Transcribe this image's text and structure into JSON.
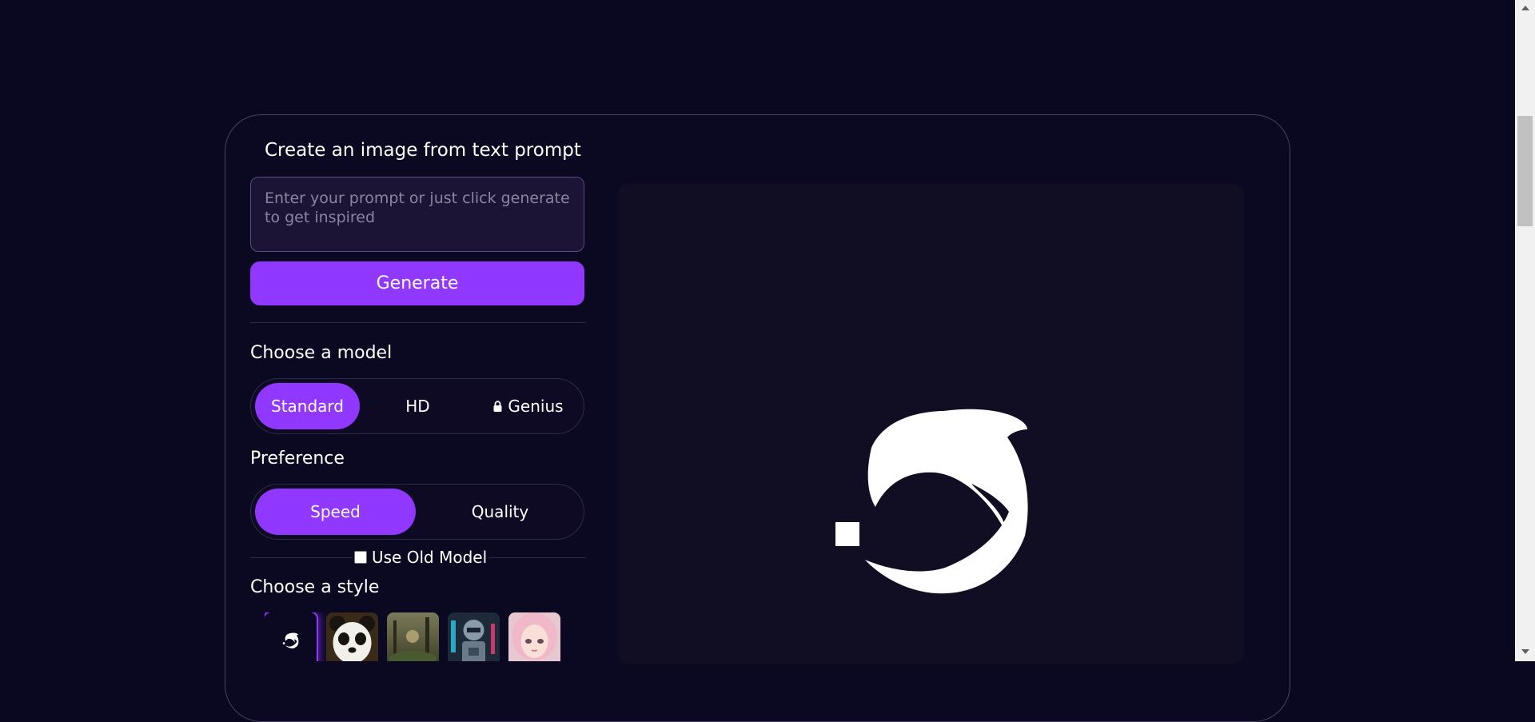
{
  "form": {
    "title": "Create an image from text prompt",
    "prompt_placeholder": "Enter your prompt or just click generate to get inspired",
    "prompt_value": "",
    "generate_label": "Generate"
  },
  "model": {
    "label": "Choose a model",
    "options": [
      "Standard",
      "HD",
      "Genius"
    ],
    "selected": "Standard",
    "locked": [
      "Genius"
    ]
  },
  "preference": {
    "label": "Preference",
    "options": [
      "Speed",
      "Quality"
    ],
    "selected": "Speed"
  },
  "old_model": {
    "label": "Use Old Model",
    "checked": false
  },
  "style": {
    "label": "Choose a style",
    "thumbnails": [
      {
        "name": "default",
        "selected": true
      },
      {
        "name": "panda",
        "selected": false
      },
      {
        "name": "landscape",
        "selected": false
      },
      {
        "name": "robot",
        "selected": false
      },
      {
        "name": "anime-girl",
        "selected": false
      }
    ]
  },
  "colors": {
    "accent": "#9038ff",
    "background": "#0a0720",
    "preview_bg": "#110e24"
  },
  "icons": {
    "preview_logo": "dolphin-logo-icon",
    "lock": "lock-icon"
  }
}
